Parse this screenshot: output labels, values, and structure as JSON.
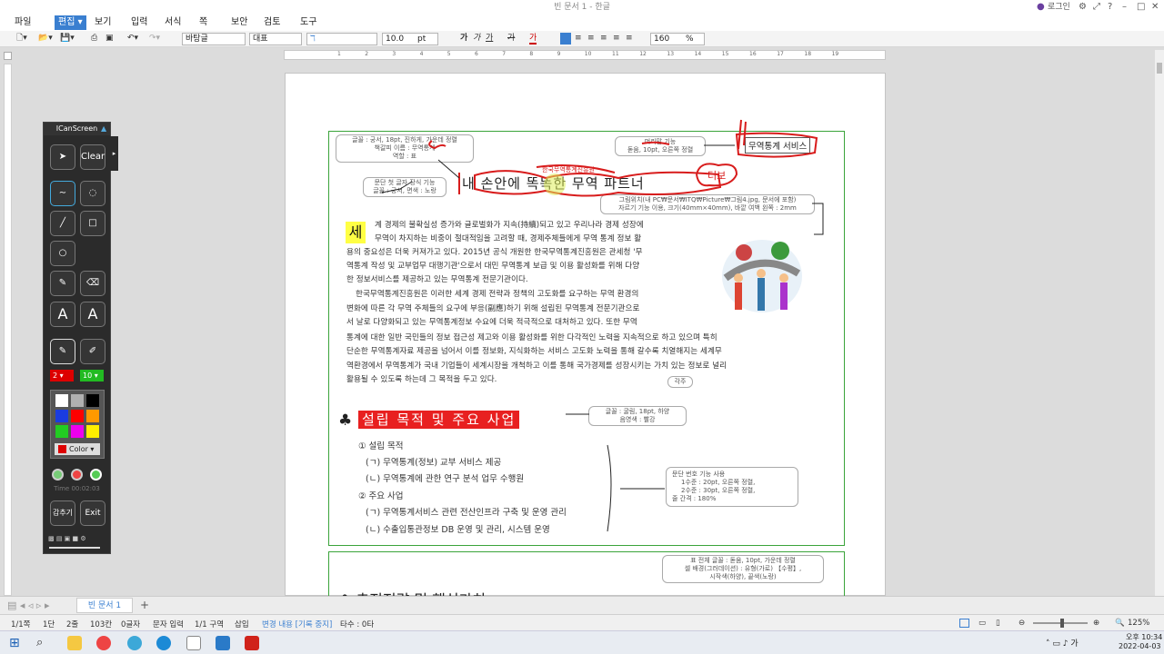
{
  "window": {
    "title": "빈 문서 1 - 한글",
    "login": "로그인"
  },
  "menu": [
    "파일",
    "편집",
    "보기",
    "입력",
    "서식",
    "쪽",
    "보안",
    "검토",
    "도구"
  ],
  "toolbar": {
    "style": "바탕글",
    "font_type": "대표",
    "font_size": "10.0",
    "unit": "pt",
    "zoom": "160",
    "zoom_unit": "%",
    "bold": "가",
    "italic": "가",
    "underline": "가",
    "strike": "가",
    "color": "가"
  },
  "ruler_ticks": [
    "1",
    "2",
    "3",
    "4",
    "5",
    "6",
    "7",
    "8",
    "9",
    "10",
    "11",
    "12",
    "13",
    "14",
    "15",
    "16",
    "17",
    "18",
    "19"
  ],
  "notes": {
    "n1": [
      "글꼴 : 궁서, 18pt, 진하게, 가운데 정렬",
      "책갈피 이름 : 무역통계",
      "역할 : 표"
    ],
    "n2": [
      "머리말 기능",
      "돋움, 10pt, 오른쪽 정렬"
    ],
    "n3": "무역통계 서비스",
    "n4": [
      "문단 첫 글자 장식 기능",
      "글꼴 : 궁서, 면색 : 노랑"
    ],
    "n5": [
      "그림위치(내 PC₩문서₩ITQ₩Picture₩그림4.jpg, 문서에 포함)",
      "자르기 기능 이용, 크기(40mm×40mm), 바깥 여백 왼쪽 : 2mm"
    ],
    "n6": "각주",
    "n7": [
      "글꼴 : 굴림, 18pt, 하양",
      "음영색 : 빨강"
    ],
    "n8": [
      "문단 번호 기능 사용",
      "1수준 : 20pt, 오른쪽 정렬,",
      "2수준 : 30pt, 오른쪽 정렬,",
      "줄 간격 : 180%"
    ],
    "n9": [
      "표 전체 글꼴 : 돋움, 10pt, 가운데 정렬",
      "셀 배경(그러데이션) : 유형(가로) 【수평】,",
      "시작색(하양), 끝색(노랑)"
    ]
  },
  "doc": {
    "title": "내 손안에 똑똑한 무역 파트너",
    "handwritten_insert": "한국무역통계진흥원",
    "handwritten_add": "더보",
    "drop_cap": "세",
    "body": [
      "계 경제의 불확실성 증가와 글로벌화가 지속(持續)되고 있고 우리나라 경제 성장에",
      "무역이 차지하는 비중이 절대적임을 고려할 때, 경제주체들에게 무역 통계 정보 활",
      "용의 중요성은 더욱 커져가고 있다. 2015년 공식 개원한 한국무역통계진흥원은 관세청 '무",
      "역통계 작성 및 교부업무 대행기관'으로서 대민 무역통계 보급 및 이용 활성화를 위해 다양",
      "한 정보서비스를 제공하고 있는 무역통계 전문기관이다.",
      "한국무역통계진흥원은 이러한 세계 경제 전략과 정책의 고도화를 요구하는 무역 환경의",
      "변화에 따른 각 무역 주체들의 요구에 부응(副應)하기 위해 설립된 무역통계 전문기관으로",
      "서 날로 다양화되고 있는 무역통계정보 수요에 더욱 적극적으로 대처하고 있다. 또한 무역",
      "통계에 대한 일반 국민들의 정보 접근성 제고와 이용 활성화를 위한 다각적인 노력을 지속적으로 하고 있으며 특히",
      "단순한 무역통계자료 제공을 넘어서 이를 정보화, 지식화하는 서비스 고도화 노력을 통해 갈수록 치열해지는 세계무",
      "역환경에서 무역통계가 국내 기업들이 세계시장을 개척하고 이를 통해 국가경제를 성장시키는 가치 있는 정보로 널리",
      "활용될 수 있도록 하는데 그 목적을 두고 있다."
    ],
    "section_title": "설립 목적 및 주요 사업",
    "section_icon": "♣",
    "list": [
      "① 설립 목적",
      "(ㄱ) 무역통계(정보) 교부 서비스 제공",
      "(ㄴ) 무역통계에 관한 연구 분석 업무 수행원",
      "② 주요 사업",
      "(ㄱ) 무역통계서비스 관련 전산인프라 구축 및 운영 관리",
      "(ㄴ) 수출입통관정보 DB 운영 및 관리, 시스템 운영"
    ],
    "next_heading": "추진전략 및 핵심가치"
  },
  "pen_tool": {
    "title": "ICanScreen",
    "clear": "Clear",
    "pen_size": "2",
    "marker_size": "10",
    "color_label": "Color",
    "time": "Time 00:02:03",
    "hide": "감추기",
    "exit": "Exit",
    "swatches": [
      "#ffffff",
      "#b0b0b0",
      "#000000",
      "#1a3ce0",
      "#ff0000",
      "#ff9900",
      "#22cc22",
      "#ee00ee",
      "#ffee00"
    ]
  },
  "tabs": {
    "doc_tab": "빈 문서 1",
    "add": "+"
  },
  "status": {
    "page": "1/1쪽",
    "section": "1단",
    "line": "2줄",
    "col": "103칸",
    "chars": "0글자",
    "input": "문자 입력",
    "area": "1/1 구역",
    "mode": "삽입",
    "track": "변경 내용 [기록 중지]",
    "typos": "타수 : 0타",
    "zoom": "125%"
  },
  "taskbar": {
    "time": "오후 10:34",
    "date": "2022-04-03"
  },
  "colors": {
    "accent": "#3a7fd0",
    "frame_green": "#3aa43a",
    "ink_red": "#d81c1c",
    "section_red": "#e82020"
  }
}
